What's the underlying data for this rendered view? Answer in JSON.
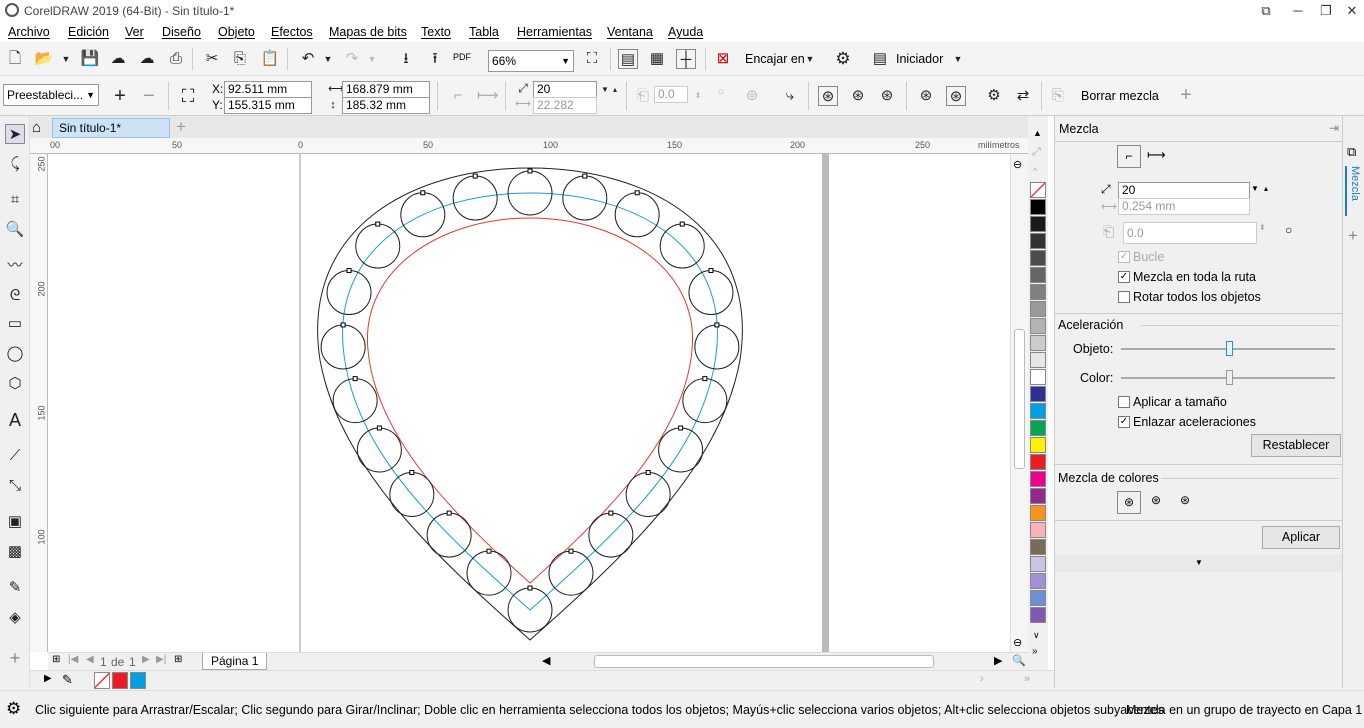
{
  "window": {
    "title": "CorelDRAW 2019 (64-Bit) - Sin título-1*"
  },
  "menu": {
    "items": [
      "Archivo",
      "Edición",
      "Ver",
      "Diseño",
      "Objeto",
      "Efectos",
      "Mapas de bits",
      "Texto",
      "Tabla",
      "Herramientas",
      "Ventana",
      "Ayuda"
    ]
  },
  "toolbar": {
    "zoom": "66%",
    "snap_label": "Encajar en",
    "launcher_label": "Iniciador",
    "pdf_label": "PDF"
  },
  "property_bar": {
    "preset": "Preestableci...",
    "x": "92.511 mm",
    "y": "155.315 mm",
    "width": "168.879 mm",
    "height": "185.32 mm",
    "x_label": "X:",
    "y_label": "Y:",
    "steps": "20",
    "spacing": "22.282 mm",
    "rotation": "0.0",
    "clear_blend_label": "Borrar mezcla"
  },
  "document": {
    "tab": "Sin título-1*"
  },
  "ruler": {
    "h_labels": [
      "00",
      "50",
      "0",
      "50",
      "100",
      "150",
      "200",
      "250"
    ],
    "h_unit": "milímetros",
    "v_labels": [
      "250",
      "200",
      "150",
      "100"
    ]
  },
  "page_nav": {
    "current": "1",
    "of_label": "de",
    "total": "1",
    "page_tab": "Página 1"
  },
  "docker": {
    "title": "Mezcla",
    "steps": "20",
    "spacing": "0.254 mm",
    "rotation": "0.0",
    "loop_label": "Bucle",
    "blend_path_label": "Mezcla en toda la ruta",
    "rotate_all_label": "Rotar todos los objetos",
    "accel_heading": "Aceleración",
    "object_label": "Objeto:",
    "color_label": "Color:",
    "apply_size_label": "Aplicar a tamaño",
    "link_accel_label": "Enlazar aceleraciones",
    "reset_label": "Restablecer",
    "color_blend_heading": "Mezcla de colores",
    "apply_label": "Aplicar",
    "object_accel": 0.5,
    "color_accel": 0.5,
    "side_tab": "Mezcla",
    "checks": {
      "loop": true,
      "blend_path": true,
      "rotate_all": false,
      "apply_size": false,
      "link_accel": true
    }
  },
  "palette": {
    "colors": [
      "#ffffff",
      "#000000",
      "#1a1a1a",
      "#333333",
      "#4d4d4d",
      "#666666",
      "#808080",
      "#999999",
      "#b3b3b3",
      "#cccccc",
      "#e6e6e6",
      "#ffffff",
      "#2e3192",
      "#00a0e3",
      "#00a651",
      "#fff200",
      "#ed1c24",
      "#ec008c",
      "#92278f",
      "#f7941d",
      "#f9b2b7",
      "#7a6a5a",
      "#c9c3e6",
      "#a58fd6",
      "#6d8fd6",
      "#7f5ab0"
    ]
  },
  "status": {
    "hint": "Clic siguiente para Arrastrar/Escalar; Clic segundo para Girar/Inclinar; Doble clic en herramienta selecciona todos los objetos; Mayús+clic selecciona varios objetos; Alt+clic selecciona objetos subyacentes",
    "selection": "Mezcla en un grupo de trayecto en Capa 1"
  },
  "colors": {
    "accent": "#1a9fd6",
    "path_red": "#e03a2c",
    "tab_bg": "#cde3f5",
    "fill_red": "#ed1c24",
    "outline_blue": "#00a0e3"
  }
}
